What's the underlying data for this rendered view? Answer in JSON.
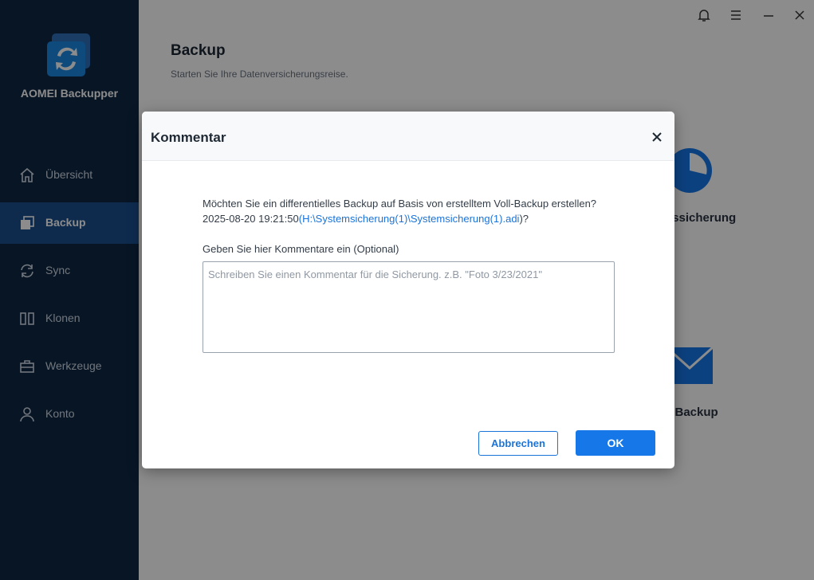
{
  "app": {
    "name": "AOMEI Backupper"
  },
  "sidebar": {
    "items": [
      {
        "label": "Übersicht",
        "icon": "home-icon",
        "active": false
      },
      {
        "label": "Backup",
        "icon": "backup-icon",
        "active": true
      },
      {
        "label": "Sync",
        "icon": "sync-icon",
        "active": false
      },
      {
        "label": "Klonen",
        "icon": "clone-icon",
        "active": false
      },
      {
        "label": "Werkzeuge",
        "icon": "toolbox-icon",
        "active": false
      },
      {
        "label": "Konto",
        "icon": "user-icon",
        "active": false
      }
    ]
  },
  "main": {
    "title": "Backup",
    "subtitle": "Starten Sie Ihre Datenversicherungsreise.",
    "cards": [
      {
        "label": "nssicherung",
        "icon": "pie-chart-icon"
      },
      {
        "label": "il Backup",
        "icon": "mail-icon"
      }
    ]
  },
  "window_controls": [
    "bell-icon",
    "menu-icon",
    "minimize-icon",
    "close-icon"
  ],
  "dialog": {
    "title": "Kommentar",
    "question_line1": "Möchten Sie ein differentielles Backup auf Basis von erstelltem Voll-Backup erstellen?",
    "question_date": "2025-08-20 19:21:50",
    "question_paren_open": "(",
    "question_link": "H:\\Systemsicherung(1)\\Systemsicherung(1).adi",
    "question_paren_close": ")?",
    "comment_label": "Geben Sie hier Kommentare ein (Optional)",
    "comment_placeholder": "Schreiben Sie einen Kommentar für die Sicherung. z.B. \"Foto 3/23/2021\"",
    "comment_value": "",
    "cancel_label": "Abbrechen",
    "ok_label": "OK"
  },
  "colors": {
    "sidebar_bg": "#0e2744",
    "sidebar_active": "#1a4f8e",
    "accent": "#1677e8",
    "link": "#1a73d9"
  }
}
